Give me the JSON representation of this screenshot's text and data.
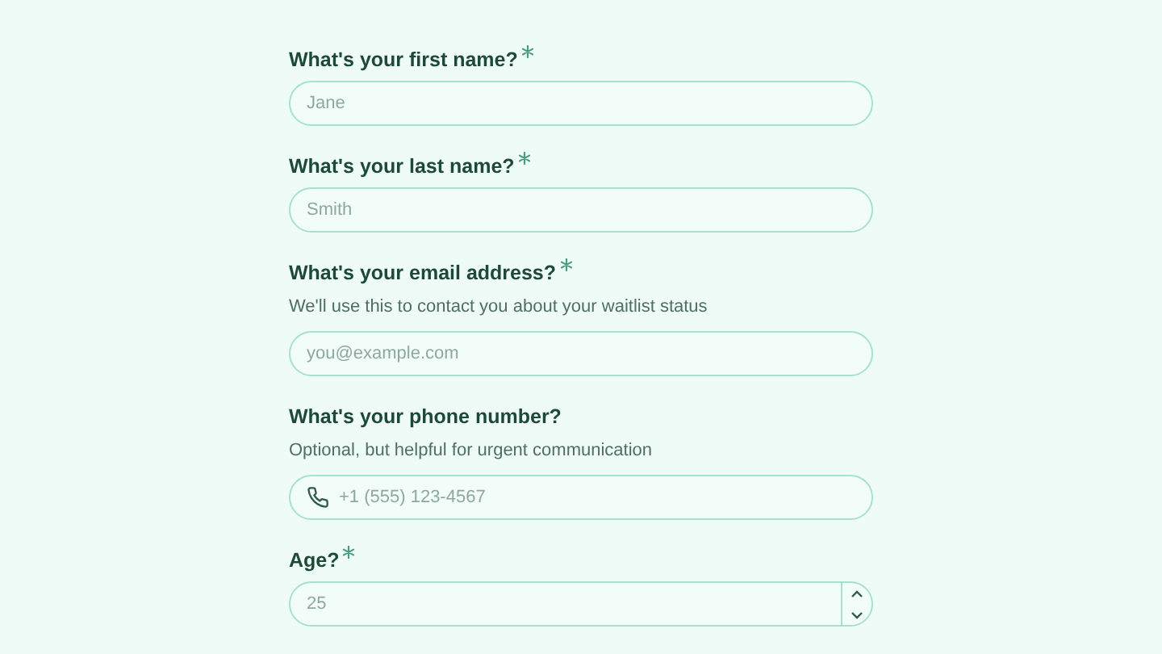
{
  "fields": [
    {
      "kind": "text",
      "label": "What's your first name?",
      "required": true,
      "placeholder": "Jane"
    },
    {
      "kind": "text",
      "label": "What's your last name?",
      "required": true,
      "placeholder": "Smith"
    },
    {
      "kind": "text",
      "label": "What's your email address?",
      "required": true,
      "hint": "We'll use this to contact you about your waitlist status",
      "placeholder": "you@example.com"
    },
    {
      "kind": "phone",
      "label": "What's your phone number?",
      "required": false,
      "hint": "Optional, but helpful for urgent communication",
      "placeholder": "+1 (555) 123-4567"
    },
    {
      "kind": "number",
      "label": "Age?",
      "required": true,
      "placeholder": "25"
    }
  ]
}
